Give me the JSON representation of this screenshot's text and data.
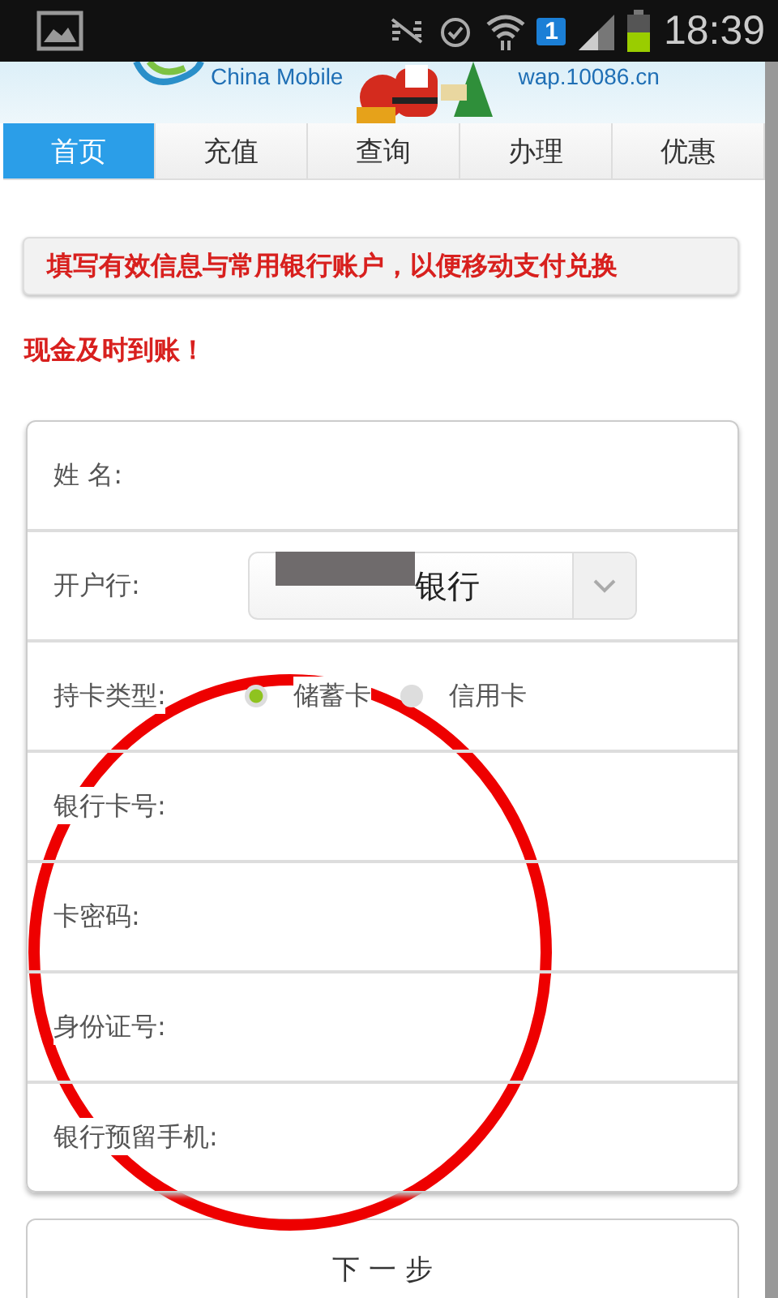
{
  "status_bar": {
    "time": "18:39",
    "sim_badge": "1"
  },
  "banner": {
    "brand": "China Mobile",
    "url": "wap.10086.cn"
  },
  "tabs": [
    {
      "label": "首页",
      "selected": true
    },
    {
      "label": "充值",
      "selected": false
    },
    {
      "label": "查询",
      "selected": false
    },
    {
      "label": "办理",
      "selected": false
    },
    {
      "label": "优惠",
      "selected": false
    }
  ],
  "notice": {
    "line_1": "填写有效信息与常用银行账户，以便移动支付兑换",
    "line_2": "现金及时到账！"
  },
  "form": {
    "rows": [
      {
        "kind": "text",
        "label": "姓 名:"
      },
      {
        "kind": "select",
        "label": "开户行:",
        "value": "银行",
        "redacted": true
      },
      {
        "kind": "radio",
        "label": "持卡类型:",
        "options": [
          {
            "label": "储蓄卡",
            "selected": true
          },
          {
            "label": "信用卡",
            "selected": false
          }
        ]
      },
      {
        "kind": "text",
        "label": "银行卡号:"
      },
      {
        "kind": "text",
        "label": "卡密码:"
      },
      {
        "kind": "text",
        "label": "身份证号:"
      },
      {
        "kind": "text",
        "label": "银行预留手机:"
      }
    ]
  },
  "next_button": "下 一 步",
  "annotation": {
    "kind": "circle"
  }
}
